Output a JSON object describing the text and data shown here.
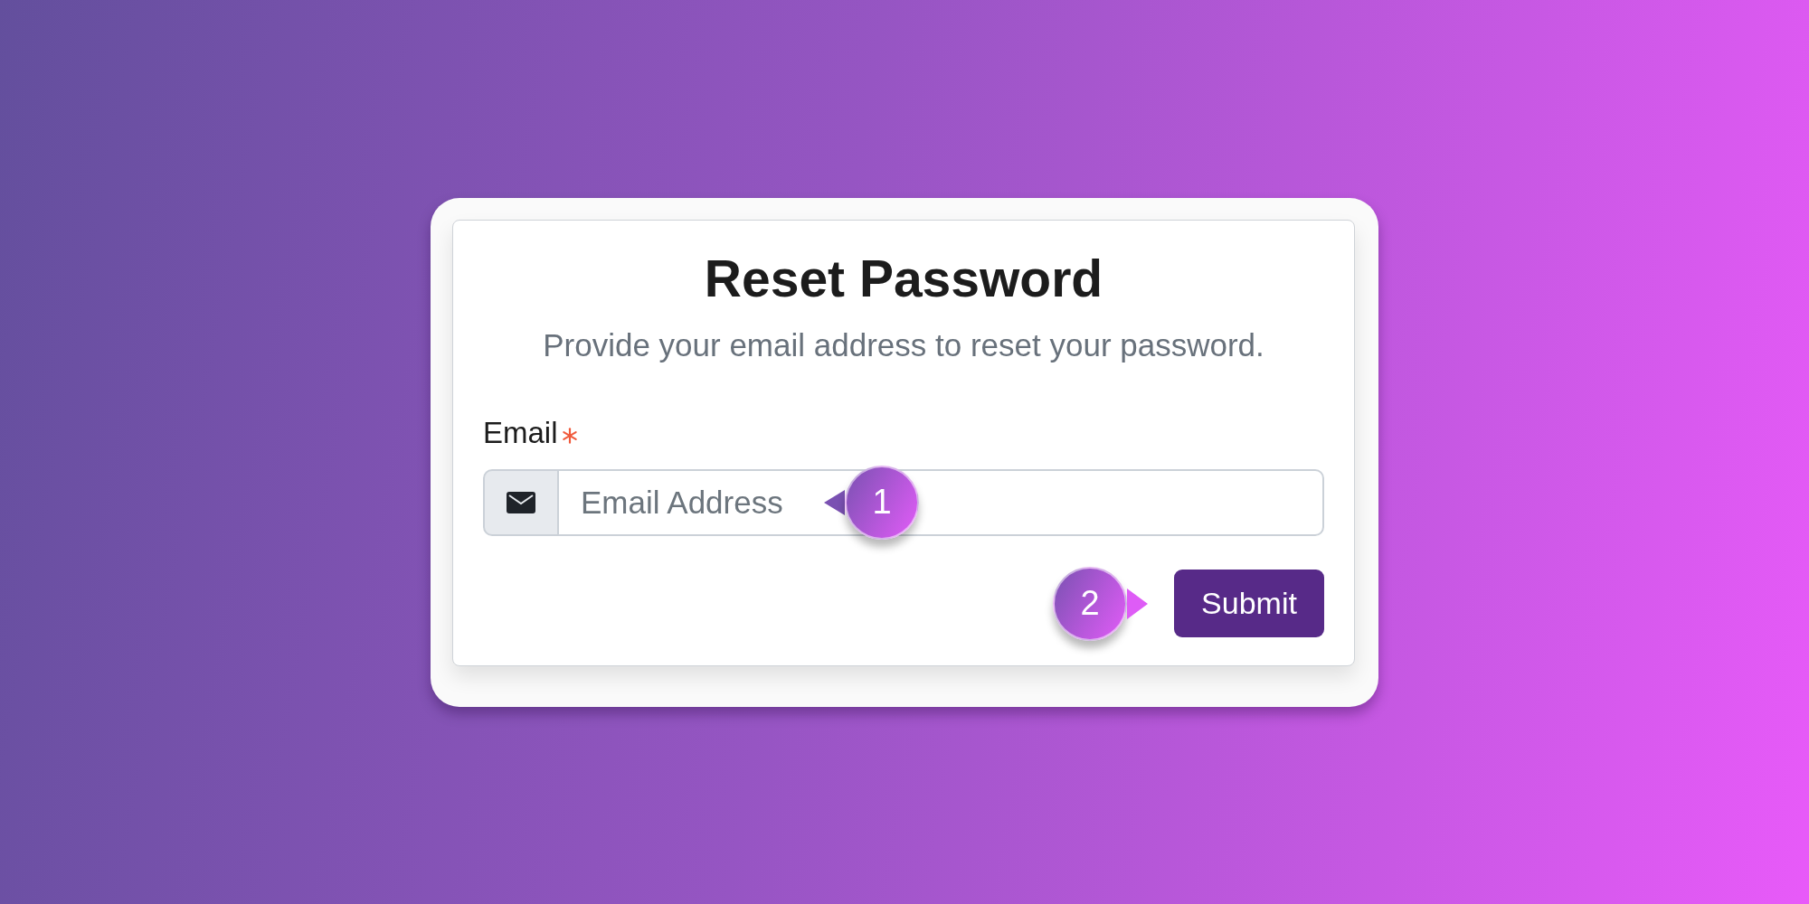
{
  "card": {
    "title": "Reset Password",
    "subtitle": "Provide your email address to reset your password.",
    "fields": [
      {
        "label": "Email",
        "required": true,
        "placeholder": "Email Address",
        "callout": {
          "label": "1",
          "kind": "left"
        }
      }
    ],
    "submit": {
      "label": "Submit",
      "callout": {
        "label": "2",
        "kind": "right"
      }
    }
  }
}
